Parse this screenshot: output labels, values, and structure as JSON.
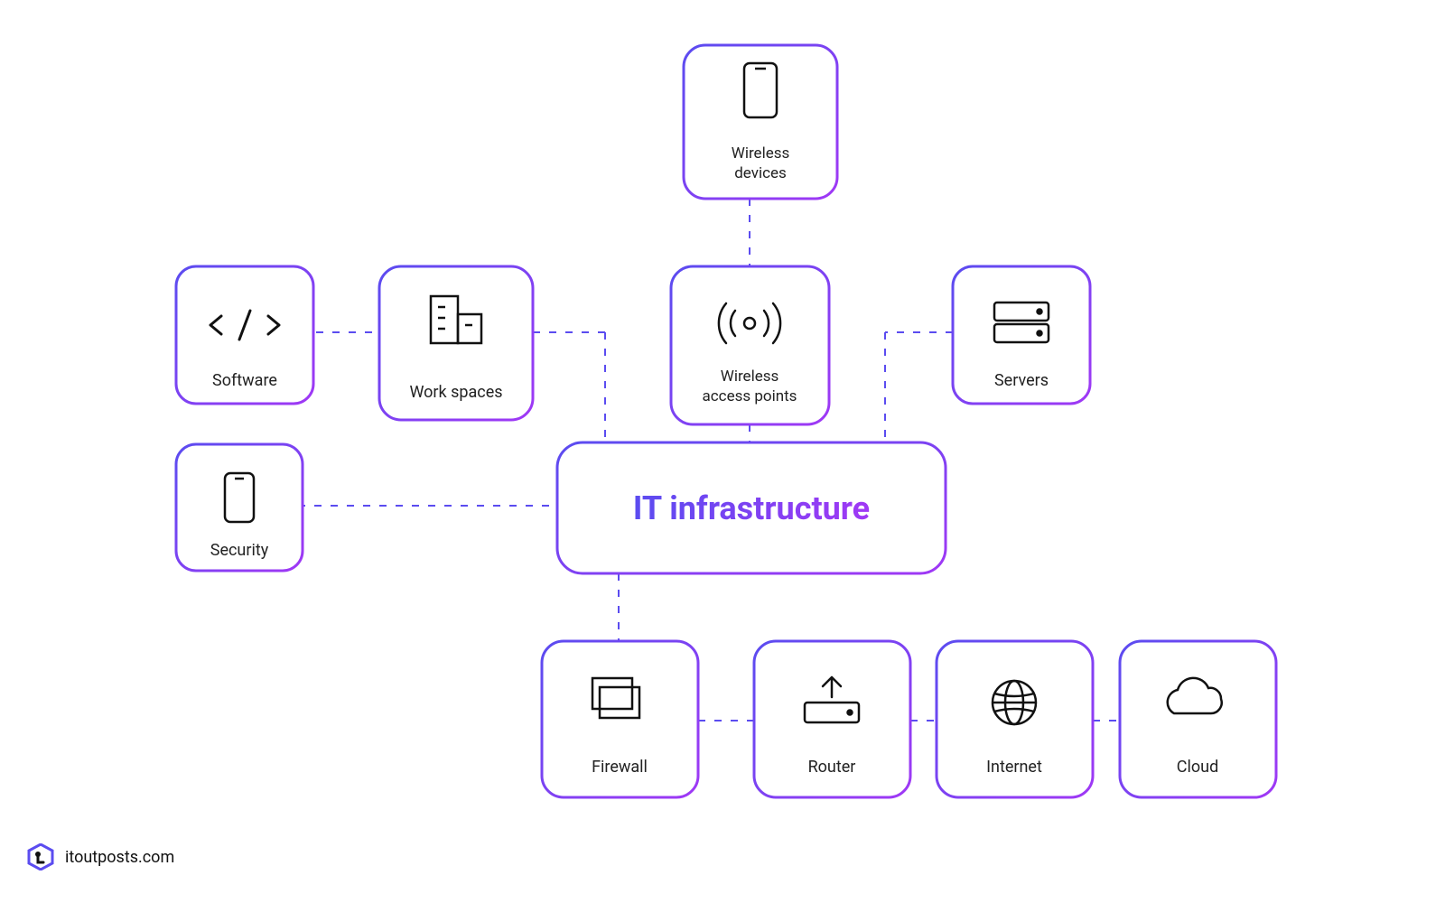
{
  "center": {
    "title": "IT infrastructure"
  },
  "nodes": {
    "wireless_devices": {
      "label1": "Wireless",
      "label2": "devices"
    },
    "software": {
      "label": "Software"
    },
    "workspaces": {
      "label": "Work spaces"
    },
    "wireless_access_points": {
      "label1": "Wireless",
      "label2": "access points"
    },
    "servers": {
      "label": "Servers"
    },
    "security": {
      "label": "Security"
    },
    "firewall": {
      "label": "Firewall"
    },
    "router": {
      "label": "Router"
    },
    "internet": {
      "label": "Internet"
    },
    "cloud": {
      "label": "Cloud"
    }
  },
  "footer": {
    "text": "itoutposts.com"
  },
  "colors": {
    "grad_start": "#5B4CF0",
    "grad_end": "#A038F5",
    "dash": "#5B4CF0",
    "icon": "#111111"
  }
}
